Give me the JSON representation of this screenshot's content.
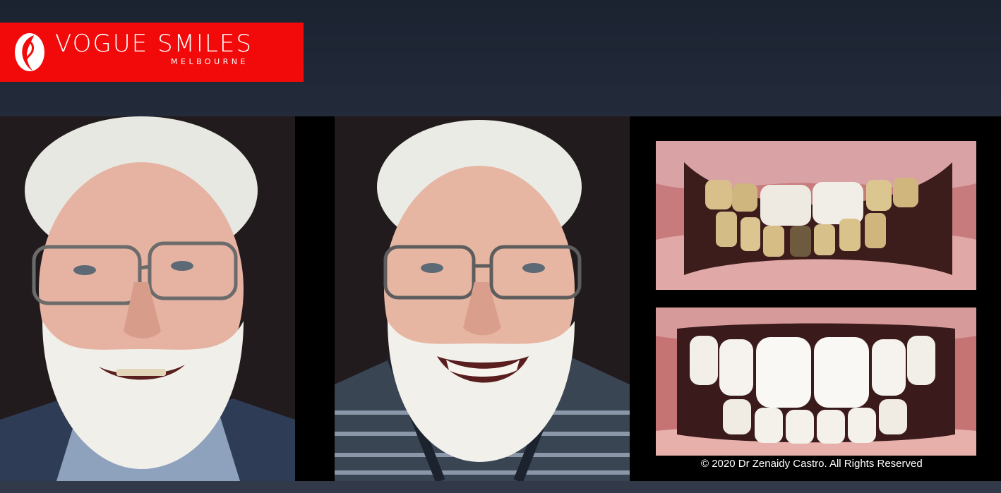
{
  "brand": {
    "name": "VOGUE SMILES",
    "city": "MELBOURNE",
    "color": "#f20a0a"
  },
  "gallery": {
    "photos": [
      {
        "label": "before-portrait",
        "icon": "portrait-photo"
      },
      {
        "label": "after-portrait",
        "icon": "portrait-photo"
      },
      {
        "label": "before-teeth",
        "icon": "teeth-photo"
      },
      {
        "label": "after-teeth",
        "icon": "teeth-photo"
      }
    ]
  },
  "copyright": "© 2020 Dr Zenaidy Castro. All Rights Reserved",
  "colors": {
    "background": "#2a3345",
    "photo_backdrop": "#221b1d",
    "text": "#ffffff"
  }
}
